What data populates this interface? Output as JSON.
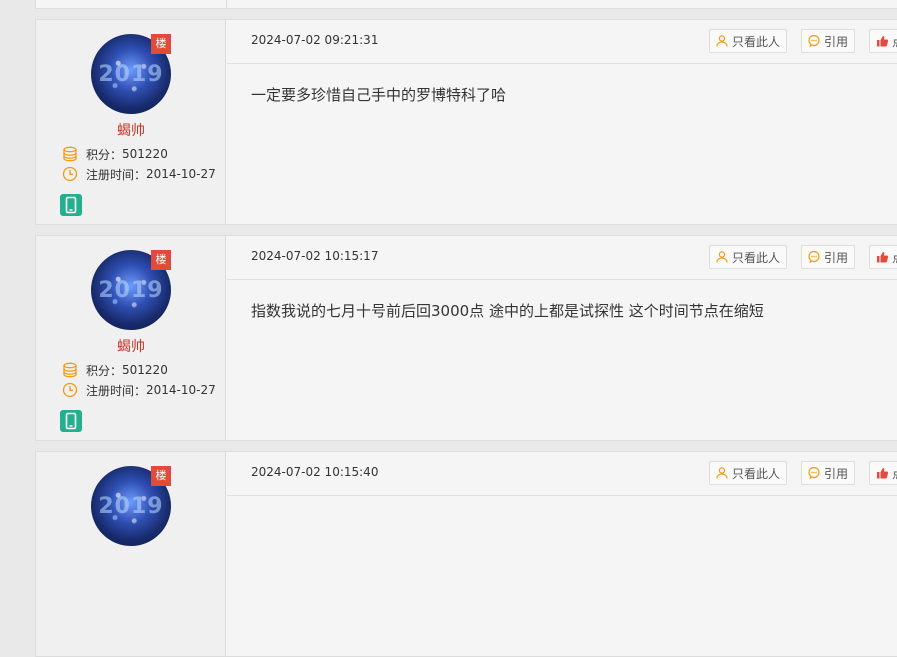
{
  "colors": {
    "username": "#c0392b",
    "floor_badge": "#e24a3c",
    "stat_icon": "#f39c12",
    "mobile_badge": "#22b08f"
  },
  "icons": {
    "points": "coins-stack-icon",
    "reg_time": "clock-icon",
    "device": "mobile-phone-icon",
    "only_author": "user-icon",
    "quote": "chat-bubble-icon",
    "like": "thumbs-up-icon"
  },
  "posts": [
    {
      "floor_badge": "楼",
      "avatar_text": "2019",
      "username": "蝎帅",
      "points_label": "积分：",
      "points_value": "501220",
      "reg_label": "注册时间：",
      "reg_value": "2014-10-27",
      "timestamp": "2024-07-02 09:21:31",
      "btn_only": "只看此人",
      "btn_quote": "引用",
      "btn_like": "点",
      "content": "一定要多珍惜自己手中的罗博特科了哈"
    },
    {
      "floor_badge": "楼",
      "avatar_text": "2019",
      "username": "蝎帅",
      "points_label": "积分：",
      "points_value": "501220",
      "reg_label": "注册时间：",
      "reg_value": "2014-10-27",
      "timestamp": "2024-07-02 10:15:17",
      "btn_only": "只看此人",
      "btn_quote": "引用",
      "btn_like": "点",
      "content": "指数我说的七月十号前后回3000点 途中的上都是试探性 这个时间节点在缩短"
    },
    {
      "floor_badge": "楼",
      "avatar_text": "2019",
      "timestamp": "2024-07-02 10:15:40",
      "btn_only": "只看此人",
      "btn_quote": "引用",
      "btn_like": "点"
    }
  ]
}
